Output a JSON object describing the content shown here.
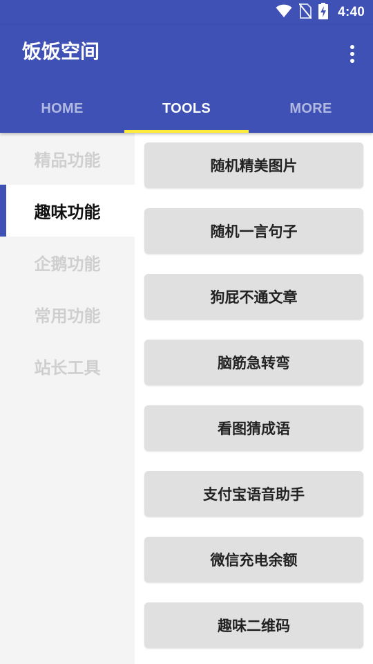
{
  "status_bar": {
    "time": "4:40",
    "icons": [
      "wifi-icon",
      "no-sim-icon",
      "battery-charging-icon"
    ]
  },
  "app_bar": {
    "title": "饭饭空间",
    "menu_icon": "overflow-menu-icon"
  },
  "tabs": [
    {
      "label": "HOME",
      "active": false
    },
    {
      "label": "TOOLS",
      "active": true
    },
    {
      "label": "MORE",
      "active": false
    }
  ],
  "sidebar": {
    "items": [
      {
        "label": "精品功能",
        "active": false
      },
      {
        "label": "趣味功能",
        "active": true
      },
      {
        "label": "企鹅功能",
        "active": false
      },
      {
        "label": "常用功能",
        "active": false
      },
      {
        "label": "站长工具",
        "active": false
      }
    ]
  },
  "tools": [
    {
      "label": "随机精美图片"
    },
    {
      "label": "随机一言句子"
    },
    {
      "label": "狗屁不通文章"
    },
    {
      "label": "脑筋急转弯"
    },
    {
      "label": "看图猜成语"
    },
    {
      "label": "支付宝语音助手"
    },
    {
      "label": "微信充电余额"
    },
    {
      "label": "趣味二维码"
    }
  ],
  "colors": {
    "primary": "#3f51b5",
    "tab_indicator": "#ffeb3b",
    "sidebar_bg": "#f4f4f4",
    "button_bg": "#e0e0e0"
  }
}
